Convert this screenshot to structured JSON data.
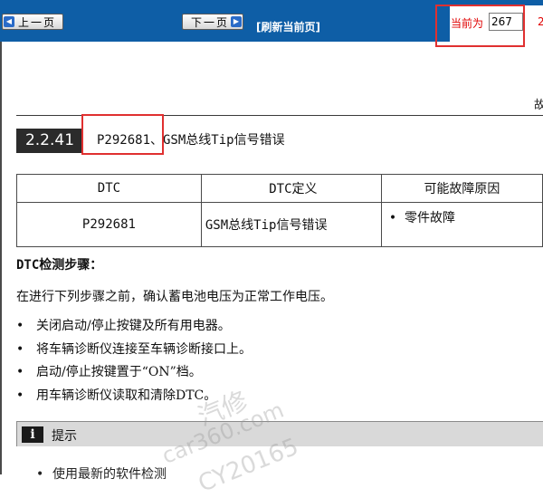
{
  "toolbar": {
    "prev_label": "上一页",
    "next_label": "下一页",
    "refresh_label": "[刷新当前页]",
    "page_label": "当前为",
    "page_value": "267",
    "page_tail": "2",
    "accent_color": "#0e5ea6"
  },
  "document": {
    "header_fragment": "故",
    "section_number": "2.2.41",
    "section_title": "P292681、GSM总线Tip信号错误",
    "table": {
      "headers": [
        "DTC",
        "DTC定义",
        "可能故障原因"
      ],
      "rows": [
        {
          "code": "P292681",
          "definition": "GSM总线Tip信号错误",
          "cause": "零件故障"
        }
      ]
    },
    "steps_title": "DTC检测步骤：",
    "intro": "在进行下列步骤之前，确认蓄电池电压为正常工作电压。",
    "bullets": [
      "关闭启动/停止按键及所有用电器。",
      "将车辆诊断仪连接至车辆诊断接口上。",
      "启动/停止按键置于“ON”档。",
      "用车辆诊断仪读取和清除DTC。"
    ],
    "hint_label": "提示",
    "hint_first_line": "使用最新的软件检测"
  },
  "watermark": {
    "line1": "汽修",
    "line2": "car360.com",
    "line3": "CY20165"
  }
}
